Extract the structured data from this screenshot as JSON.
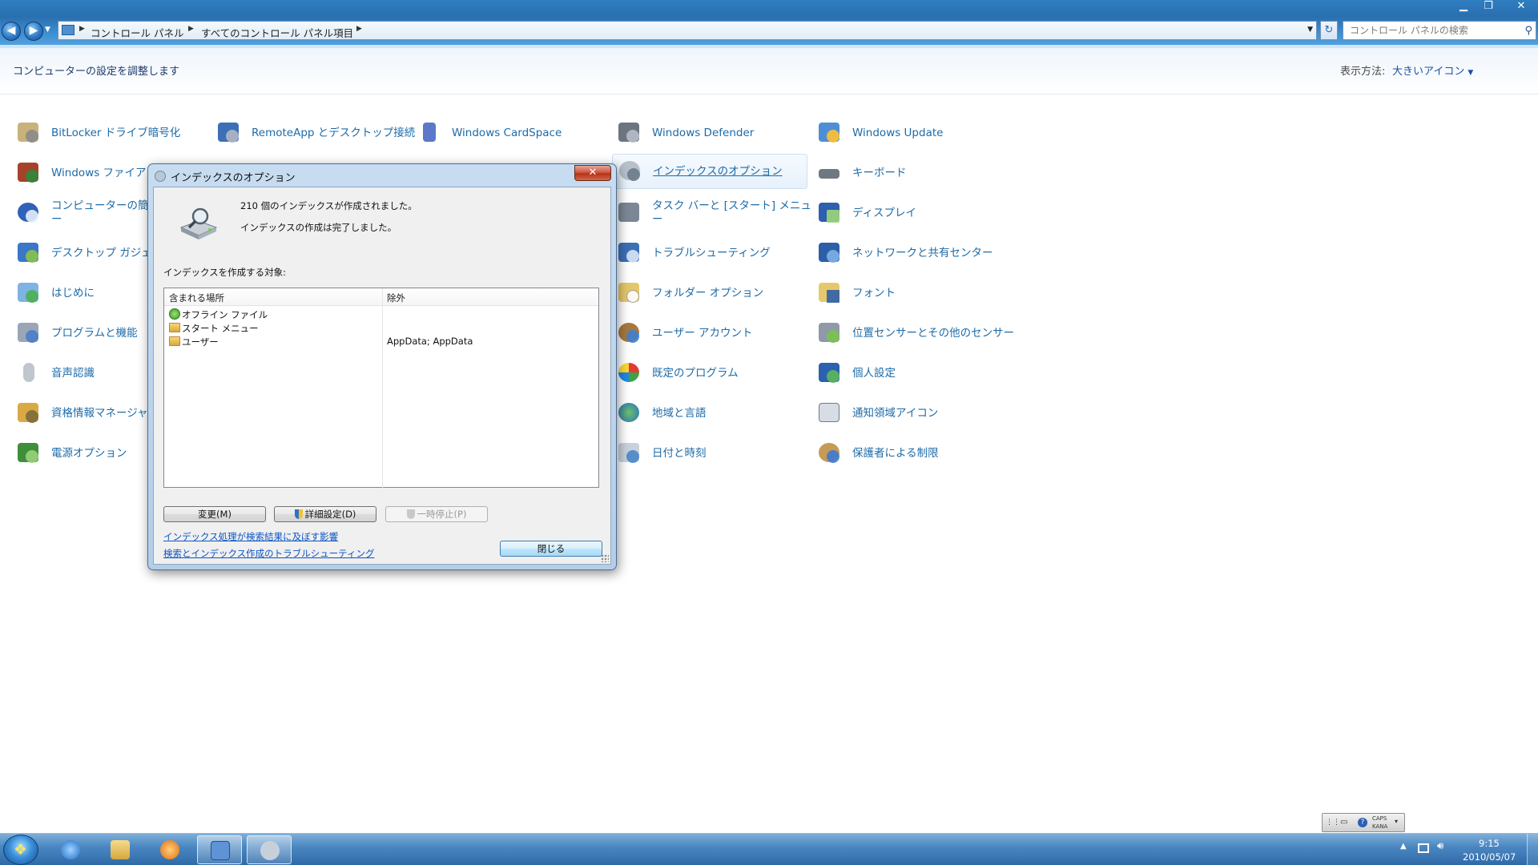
{
  "window": {
    "breadcrumbs": [
      "コントロール パネル",
      "すべてのコントロール パネル項目"
    ],
    "search_placeholder": "コントロール パネルの検索"
  },
  "header": {
    "title": "コンピューターの設定を調整します",
    "view_label": "表示方法:",
    "view_value": "大きいアイコン"
  },
  "items": {
    "bitlocker": {
      "label": "BitLocker ドライブ暗号化",
      "icon": "bitlocker-icon"
    },
    "remoteapp": {
      "label": "RemoteApp とデスクトップ接続",
      "icon": "remoteapp-icon"
    },
    "cardspace": {
      "label": "Windows CardSpace",
      "icon": "cardspace-icon"
    },
    "defender": {
      "label": "Windows Defender",
      "icon": "defender-icon"
    },
    "update": {
      "label": "Windows Update",
      "icon": "windows-update-icon"
    },
    "firewall": {
      "label": "Windows ファイアウ",
      "icon": "firewall-icon"
    },
    "indexing": {
      "label": "インデックスのオプション",
      "icon": "indexing-icon"
    },
    "keyboard": {
      "label": "キーボード",
      "icon": "keyboard-icon"
    },
    "ease": {
      "label": "コンピューターの簡単\nー",
      "icon": "ease-of-access-icon"
    },
    "taskbar": {
      "label": "タスク バーと [スタート] メニュ\nー",
      "icon": "taskbar-icon"
    },
    "display": {
      "label": "ディスプレイ",
      "icon": "display-icon"
    },
    "gadgets": {
      "label": "デスクトップ ガジェッ",
      "icon": "gadgets-icon"
    },
    "troubleshoot": {
      "label": "トラブルシューティング",
      "icon": "troubleshooting-icon"
    },
    "network": {
      "label": "ネットワークと共有センター",
      "icon": "network-icon"
    },
    "getting_started": {
      "label": "はじめに",
      "icon": "getting-started-icon"
    },
    "folder_options": {
      "label": "フォルダー オプション",
      "icon": "folder-options-icon"
    },
    "fonts": {
      "label": "フォント",
      "icon": "fonts-icon"
    },
    "programs": {
      "label": "プログラムと機能",
      "icon": "programs-icon"
    },
    "user_accounts": {
      "label": "ユーザー アカウント",
      "icon": "user-accounts-icon"
    },
    "location": {
      "label": "位置センサーとその他のセンサー",
      "icon": "location-sensor-icon"
    },
    "speech": {
      "label": "音声認識",
      "icon": "microphone-icon"
    },
    "default_programs": {
      "label": "既定のプログラム",
      "icon": "default-programs-icon"
    },
    "personalize": {
      "label": "個人設定",
      "icon": "personalization-icon"
    },
    "credential": {
      "label": "資格情報マネージャー",
      "icon": "credential-manager-icon"
    },
    "region": {
      "label": "地域と言語",
      "icon": "region-language-icon"
    },
    "notify": {
      "label": "通知領域アイコン",
      "icon": "notification-area-icon"
    },
    "power": {
      "label": "電源オプション",
      "icon": "power-options-icon"
    },
    "datetime": {
      "label": "日付と時刻",
      "icon": "date-time-icon"
    },
    "parental": {
      "label": "保護者による制限",
      "icon": "parental-controls-icon"
    }
  },
  "dialog": {
    "title": "インデックスのオプション",
    "close_glyph": "✕",
    "status_count": "210 個のインデックスが作成されました。",
    "status_done": "インデックスの作成は完了しました。",
    "targets_label": "インデックスを作成する対象:",
    "columns": {
      "included": "含まれる場所",
      "excluded": "除外"
    },
    "rows": [
      {
        "location": "オフライン ファイル",
        "excluded": ""
      },
      {
        "location": "スタート メニュー",
        "excluded": ""
      },
      {
        "location": "ユーザー",
        "excluded": "AppData; AppData"
      }
    ],
    "btn_change": "変更(M)",
    "btn_advanced": "詳細設定(D)",
    "btn_pause": "一時停止(P)",
    "link_affect": "インデックス処理が検索結果に及ぼす影響",
    "link_trouble": "検索とインデックス作成のトラブルシューティング",
    "btn_close": "閉じる"
  },
  "ime": {
    "caps": "CAPS",
    "kana": "KANA"
  },
  "taskbar": {
    "time": "9:15",
    "date": "2010/05/07"
  },
  "colors": {
    "link": "#1d6ba8",
    "accent": "#2a6fb0",
    "taskbar": "#3a75b0"
  }
}
